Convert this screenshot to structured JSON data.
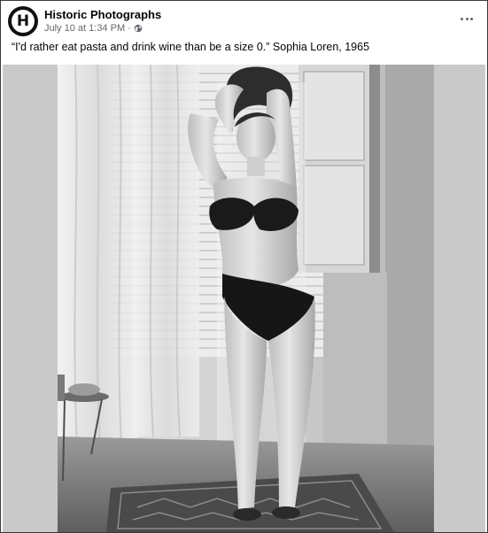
{
  "post": {
    "author": "Historic Photographs",
    "avatar_letter": "H",
    "timestamp": "July 10 at 1:34 PM",
    "separator": "·",
    "privacy_icon": "globe-icon",
    "more_icon": "more-options-icon",
    "caption": "“I'd rather eat pasta and drink wine than be a size 0.” Sophia Loren, 1965"
  },
  "photo": {
    "subject": "black-and-white photograph of a woman in a dark bikini standing by a window",
    "tone": "monochrome"
  }
}
